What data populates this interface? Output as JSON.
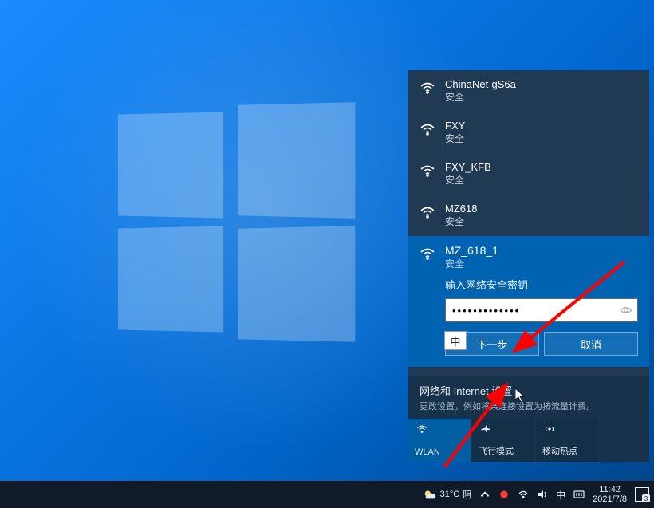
{
  "networks": [
    {
      "name": "ChinaNet-gS6a",
      "status": "安全"
    },
    {
      "name": "FXY",
      "status": "安全"
    },
    {
      "name": "FXY_KFB",
      "status": "安全"
    },
    {
      "name": "MZ618",
      "status": "安全"
    }
  ],
  "selected": {
    "name": "MZ_618_1",
    "status": "安全",
    "prompt": "输入网络安全密钥",
    "password_mask": "•••••••••••••",
    "next_label": "下一步",
    "cancel_label": "取消",
    "ime_badge": "中"
  },
  "settings": {
    "title": "网络和 Internet 设置",
    "subtitle": "更改设置，例如将某连接设置为按流量计费。"
  },
  "tiles": {
    "wlan": "WLAN",
    "airplane": "飞行模式",
    "hotspot": "移动热点"
  },
  "taskbar": {
    "weather_temp": "31°C",
    "weather_desc": "阴",
    "ime": "中",
    "time": "11:42",
    "date": "2021/7/8",
    "notif_count": "3"
  }
}
